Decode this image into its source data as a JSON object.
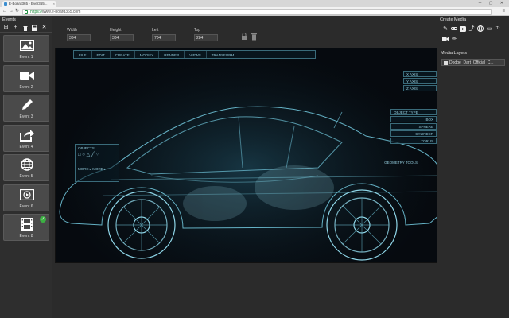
{
  "browser": {
    "tab_title": "E-Board365 - Ever365...",
    "url_scheme": "https://",
    "url_rest": "www.e-board365.com",
    "back_glyph": "←",
    "forward_glyph": "→",
    "reload_glyph": "↻",
    "menu_glyph": "≡",
    "window_controls": "─ ▢ ✕",
    "tab_close_glyph": "×"
  },
  "left_panel": {
    "title": "Events",
    "toolbar": [
      {
        "name": "grid-icon",
        "glyph": "⊞"
      },
      {
        "name": "add-icon",
        "glyph": "+"
      },
      {
        "name": "trash-icon",
        "glyph": "🗑"
      },
      {
        "name": "save-icon",
        "glyph": "💾"
      },
      {
        "name": "close-icon",
        "glyph": "✕"
      }
    ],
    "events": [
      {
        "label": "Event 1",
        "icon": "image-icon"
      },
      {
        "label": "Event 2",
        "icon": "video-camera-icon"
      },
      {
        "label": "Event 3",
        "icon": "pencil-icon"
      },
      {
        "label": "Event 4",
        "icon": "share-icon"
      },
      {
        "label": "Event 5",
        "icon": "globe-icon"
      },
      {
        "label": "Event 6",
        "icon": "youtube-icon"
      },
      {
        "label": "Event 8",
        "icon": "film-icon",
        "checked": true,
        "check_glyph": "✓"
      }
    ]
  },
  "properties": {
    "width_label": "Width",
    "width_value": "384",
    "height_label": "Height",
    "height_value": "384",
    "left_label": "Left",
    "left_value": "704",
    "top_label": "Top",
    "top_value": "284"
  },
  "canvas": {
    "menu": [
      "FILE",
      "EDIT",
      "CREATE",
      "MODIFY",
      "RENDER",
      "VIEWS",
      "TRANSFORM"
    ],
    "axes": [
      "X AXIS",
      "Y AXIS",
      "Z AXIS"
    ],
    "object_type_title": "OBJECT TYPE",
    "object_types": [
      "BOX",
      "SPHERE",
      "CYLINDER",
      "TORUS"
    ],
    "geometry_label": "GEOMETRY TOOLS",
    "objects_title": "OBJECTS",
    "objects_shapes": "□ ○ △ ╱ ⁘",
    "objects_more": "MORE ▸   MORE ▸"
  },
  "right_panel": {
    "title": "Create Media",
    "tools": [
      {
        "name": "pencil-icon",
        "glyph": "✎"
      },
      {
        "name": "link-icon",
        "glyph": "🔗"
      },
      {
        "name": "youtube-icon",
        "glyph": "▶"
      },
      {
        "name": "share-icon",
        "glyph": "⤴"
      },
      {
        "name": "globe-icon",
        "glyph": "◍"
      },
      {
        "name": "presentation-icon",
        "glyph": "▭"
      },
      {
        "name": "text-icon",
        "glyph": "Tt"
      },
      {
        "name": "video-camera-icon",
        "glyph": "■"
      },
      {
        "name": "pen-icon",
        "glyph": "✏"
      }
    ],
    "layers_title": "Media Layers",
    "layers": [
      "Dodge_Dart_Official_C..."
    ]
  }
}
